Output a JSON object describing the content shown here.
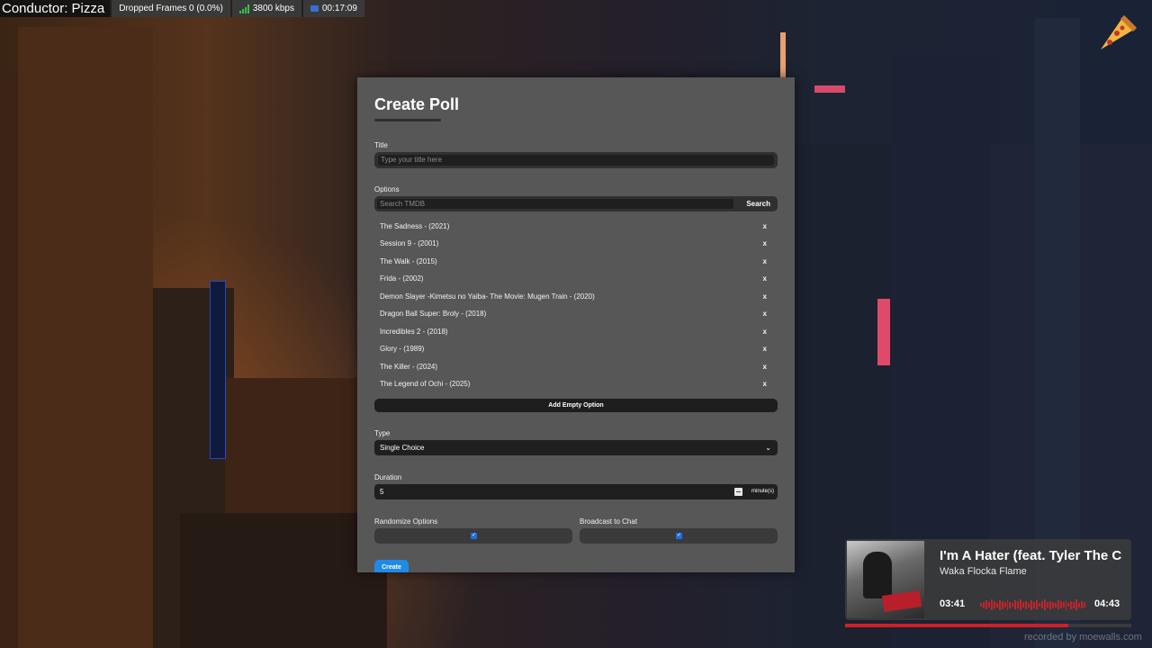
{
  "overlay": {
    "conductor": "Conductor: Pizza",
    "dropped_frames": "Dropped Frames 0 (0.0%)",
    "bitrate": "3800 kbps",
    "uptime": "00:17:09"
  },
  "poll": {
    "heading": "Create Poll",
    "title_label": "Title",
    "title_placeholder": "Type your title here",
    "options_label": "Options",
    "search_placeholder": "Search TMDB",
    "search_button": "Search",
    "options": [
      {
        "label": "The Sadness - (2021)",
        "remove": "x"
      },
      {
        "label": "Session 9 - (2001)",
        "remove": "x"
      },
      {
        "label": "The Walk - (2015)",
        "remove": "x"
      },
      {
        "label": "Frida - (2002)",
        "remove": "x"
      },
      {
        "label": "Demon Slayer -Kimetsu no Yaiba- The Movie: Mugen Train - (2020)",
        "remove": "x"
      },
      {
        "label": "Dragon Ball Super: Broly - (2018)",
        "remove": "x"
      },
      {
        "label": "Incredibles 2 - (2018)",
        "remove": "x"
      },
      {
        "label": "Glory - (1989)",
        "remove": "x"
      },
      {
        "label": "The Killer - (2024)",
        "remove": "x"
      },
      {
        "label": "The Legend of Ochi - (2025)",
        "remove": "x"
      }
    ],
    "add_empty_option": "Add Empty Option",
    "type_label": "Type",
    "type_value": "Single Choice",
    "duration_label": "Duration",
    "duration_value": "5",
    "duration_unit": "minute(s)",
    "randomize_label": "Randomize Options",
    "randomize_checked": true,
    "broadcast_label": "Broadcast to Chat",
    "broadcast_checked": true,
    "create_button": "Create"
  },
  "now_playing": {
    "title": "I'm A Hater (feat. Tyler The C",
    "artist": "Waka Flocka Flame",
    "elapsed": "03:41",
    "total": "04:43",
    "progress": 0.78
  },
  "watermark": "recorded by moewalls.com",
  "colors": {
    "modal_bg": "#575757",
    "accent_blue": "#1f8ae8",
    "progress_red": "#cf1f26"
  }
}
